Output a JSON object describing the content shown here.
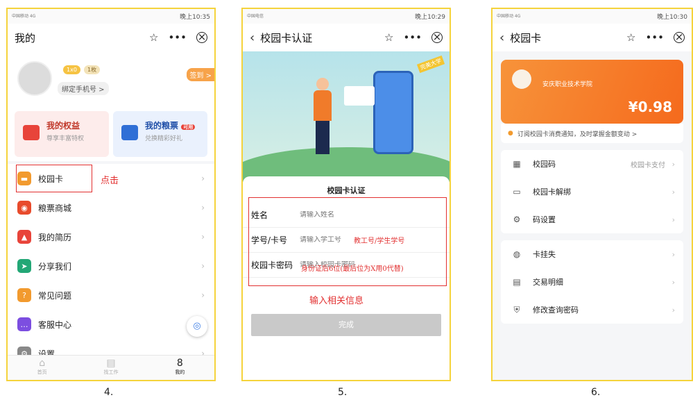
{
  "status_bar": {
    "carrier_lines": [
      "中国移动 4G",
      "中国电信"
    ],
    "times": [
      "晚上10:35",
      "晚上10:29",
      "晚上10:30"
    ]
  },
  "phone1": {
    "title": "我的",
    "level_badge": "1x0",
    "coin_badge": "1枚",
    "bind_phone": "绑定手机号 >",
    "sign_in": "签到 >",
    "card_rights": {
      "title": "我的权益",
      "sub": "尊享丰富特权"
    },
    "card_coupon": {
      "title": "我的粮票",
      "sub": "兑换精彩好礼",
      "tag": "可用"
    },
    "menu": [
      {
        "label": "校园卡",
        "icon": "card-icon",
        "color": "#f29a2e"
      },
      {
        "label": "粮票商城",
        "icon": "mall-icon",
        "color": "#e84b2c"
      },
      {
        "label": "我的简历",
        "icon": "resume-icon",
        "color": "#e8443a"
      },
      {
        "label": "分享我们",
        "icon": "share-icon",
        "color": "#23a776"
      },
      {
        "label": "常见问题",
        "icon": "question-icon",
        "color": "#f29a2e"
      },
      {
        "label": "客服中心",
        "icon": "service-icon",
        "color": "#7c4ee0"
      },
      {
        "label": "设置",
        "icon": "settings-icon",
        "color": "#888888"
      }
    ],
    "annotation": "点击",
    "tabs": [
      "首页",
      "找工作",
      "我的"
    ]
  },
  "phone2": {
    "title": "校园卡认证",
    "ribbon": "完美大学",
    "form_title": "校园卡认证",
    "fields": [
      {
        "label": "姓名",
        "placeholder": "请输入姓名"
      },
      {
        "label": "学号/卡号",
        "placeholder": "请输入学工号"
      },
      {
        "label": "校园卡密码",
        "placeholder": "请输入校园卡密码"
      }
    ],
    "note_id": "教工号/学生学号",
    "note_pwd": "身份证后6位(最后位为X用0代替)",
    "note_input": "输入相关信息",
    "submit": "完成"
  },
  "phone3": {
    "title": "校园卡",
    "school": "安庆职业技术学院",
    "balance": "¥0.98",
    "notice": "订阅校园卡消费通知，及时掌握金额变动 >",
    "group1": [
      {
        "label": "校园码",
        "right": "校园卡支付",
        "icon": "qr-icon"
      },
      {
        "label": "校园卡解绑",
        "right": "",
        "icon": "unbind-icon"
      },
      {
        "label": "码设置",
        "right": "",
        "icon": "gear-icon"
      }
    ],
    "group2": [
      {
        "label": "卡挂失",
        "right": "",
        "icon": "lock-icon"
      },
      {
        "label": "交易明细",
        "right": "",
        "icon": "receipt-icon"
      },
      {
        "label": "修改查询密码",
        "right": "",
        "icon": "shield-icon"
      }
    ]
  },
  "steps": [
    "4.",
    "5.",
    "6."
  ]
}
